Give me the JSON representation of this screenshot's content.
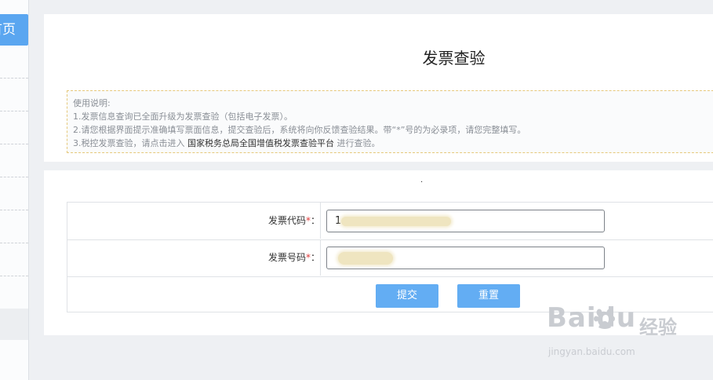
{
  "sidebar": {
    "home_label": "首页"
  },
  "header": {
    "title": "发票查验"
  },
  "notes": {
    "heading": "使用说明:",
    "line1": "1.发票信息查询已全面升级为发票查验（包括电子发票）。",
    "line2": "2.请您根据界面提示准确填写票面信息，提交查验后，系统将向你反馈查验结果。带“*”号的为必录项，请您完整填写。",
    "line3_prefix": "3.税控发票查验，请点击进入",
    "line3_link": "国家税务总局全国增值税发票查验平台",
    "line3_suffix": "进行查验。"
  },
  "form": {
    "dot": "·",
    "invoice_code_label": "发票代码",
    "invoice_code_value": "1",
    "invoice_number_label": "发票号码",
    "required_mark": "*",
    "colon": "：",
    "submit_label": "提交",
    "reset_label": "重置"
  },
  "watermark": {
    "brand": "Baidu",
    "suffix": "经验",
    "url": "jingyan.baidu.com"
  },
  "colors": {
    "accent": "#5aa6f0",
    "button": "#63adf3",
    "required": "#e03b3b",
    "notes_border": "#e6c87a"
  }
}
